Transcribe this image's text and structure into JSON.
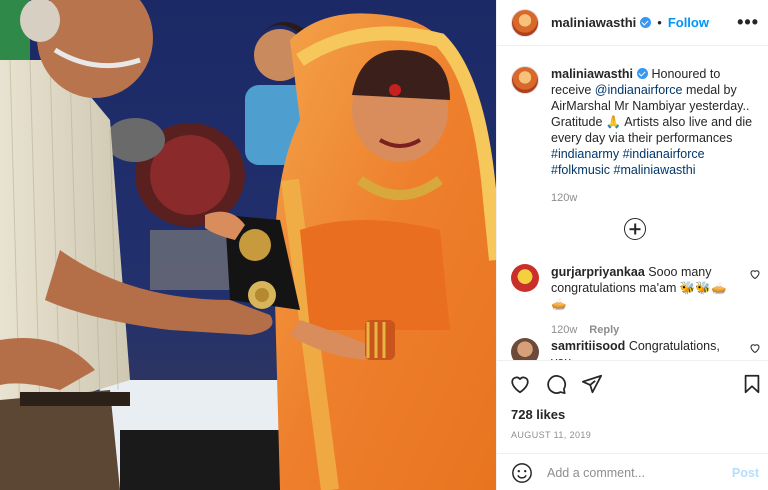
{
  "post": {
    "username": "maliniawasthi",
    "follow_label": "Follow",
    "separator": "•",
    "more_label": "•••",
    "caption_text": "Honoured to receive ",
    "caption_mention": "@indianairforce",
    "caption_rest": " medal by AirMarshal Mr Nambiyar yesterday.. Gratitude 🙏 Artists also live and die every day via their performances ",
    "caption_hashtags": "#indianarmy #indianairforce #folkmusic #maliniawasthi",
    "time": "120w",
    "likes": "728 likes",
    "date": "AUGUST 11, 2019"
  },
  "comments": [
    {
      "username": "gurjarpriyankaa",
      "text": "Sooo many congratulations ma'am 🐝🐝🥧🥧",
      "time": "120w",
      "reply_label": "Reply",
      "avatar_color": "#c9302c"
    },
    {
      "username": "samritiisood",
      "text": "Congratulations, you",
      "time": "",
      "reply_label": "",
      "avatar_color": "#6b4a3a"
    }
  ],
  "add_comment": {
    "placeholder": "Add a comment...",
    "post_label": "Post"
  },
  "icons": {
    "like": "heart-icon",
    "comment": "comment-icon",
    "share": "share-icon",
    "save": "bookmark-icon",
    "emoji": "emoji-icon",
    "load_more": "plus-circle-icon"
  },
  "colors": {
    "link": "#00376b",
    "follow": "#0095f6",
    "verified": "#3897f0",
    "muted": "#8e8e8e"
  }
}
